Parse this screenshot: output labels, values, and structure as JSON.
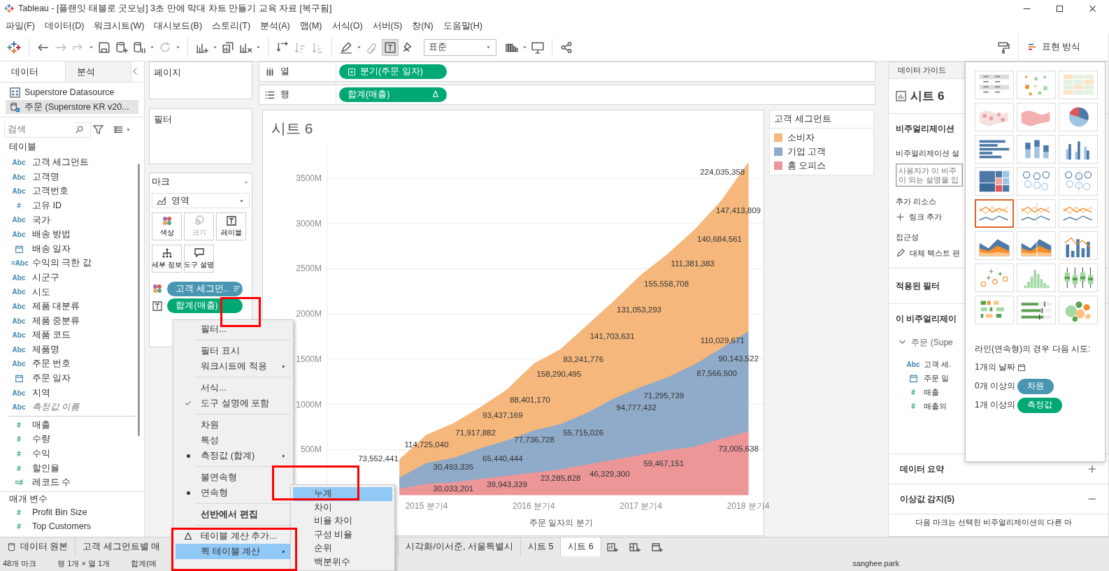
{
  "window": {
    "title": "Tableau - [플랜잇 태블로 굿모닝] 3초 만에 막대 차트 만들기 교육 자료 [복구됨]"
  },
  "menu": [
    "파일(F)",
    "데이터(D)",
    "워크시트(W)",
    "대시보드(B)",
    "스토리(T)",
    "분석(A)",
    "맵(M)",
    "서식(O)",
    "서버(S)",
    "창(N)",
    "도움말(H)"
  ],
  "toolbar": [
    {
      "kind": "logo"
    },
    {
      "kind": "sep"
    },
    {
      "kind": "undo",
      "disabled": false
    },
    {
      "kind": "redo",
      "disabled": true
    },
    {
      "kind": "replay",
      "disabled": true,
      "dropdown": true
    },
    {
      "kind": "save",
      "disabled": false
    },
    {
      "kind": "newds",
      "disabled": false
    },
    {
      "kind": "pause",
      "disabled": false,
      "dropdown": true
    },
    {
      "kind": "refresh",
      "disabled": true,
      "dropdown": true
    },
    {
      "kind": "sep"
    },
    {
      "kind": "newsheet",
      "disabled": false,
      "dropdown": true
    },
    {
      "kind": "duplicate",
      "disabled": false
    },
    {
      "kind": "clear",
      "disabled": false,
      "dropdown": true
    },
    {
      "kind": "sep"
    },
    {
      "kind": "swap",
      "disabled": false
    },
    {
      "kind": "sortasc",
      "disabled": true
    },
    {
      "kind": "sortdesc",
      "disabled": true
    },
    {
      "kind": "sep"
    },
    {
      "kind": "highlight",
      "disabled": false,
      "dropdown": true
    },
    {
      "kind": "group",
      "disabled": true
    },
    {
      "kind": "labels",
      "disabled": false,
      "on": true
    },
    {
      "kind": "fixaxes",
      "disabled": false
    },
    {
      "kind": "fit",
      "value": "표준"
    },
    {
      "kind": "cards",
      "disabled": false,
      "dropdown": true
    },
    {
      "kind": "present",
      "disabled": false
    },
    {
      "kind": "sep"
    },
    {
      "kind": "share",
      "disabled": false
    }
  ],
  "show_me_button": {
    "label": "표현 방식",
    "selected": true
  },
  "data_pane": {
    "tabs": [
      {
        "label": "데이터",
        "selected": true
      },
      {
        "label": "분석",
        "selected": false
      }
    ],
    "sources": [
      {
        "name": "Superstore Datasource",
        "selected": false
      },
      {
        "name": "주문 (Superstore KR v20...",
        "selected": true
      }
    ],
    "search": {
      "placeholder": "검색"
    },
    "tables_header": "테이블",
    "fields": [
      {
        "name": "고객 세그먼트",
        "kind": "typed",
        "type_label": "Abc",
        "measure": false
      },
      {
        "name": "고객명",
        "kind": "typed",
        "type_label": "Abc",
        "measure": false
      },
      {
        "name": "고객번호",
        "kind": "typed",
        "type_label": "Abc",
        "measure": false
      },
      {
        "name": "고유 ID",
        "kind": "typed",
        "type_label": "#",
        "measure": false
      },
      {
        "name": "국가",
        "kind": "typed",
        "type_label": "Abc",
        "measure": false
      },
      {
        "name": "배송 방법",
        "kind": "typed",
        "type_label": "Abc",
        "measure": false
      },
      {
        "name": "배송 일자",
        "kind": "date",
        "measure": false
      },
      {
        "name": "수익의 극한 값",
        "kind": "typed",
        "type_label": "=Abc",
        "measure": false
      },
      {
        "name": "시군구",
        "kind": "typed",
        "type_label": "Abc",
        "measure": false
      },
      {
        "name": "시도",
        "kind": "typed",
        "type_label": "Abc",
        "measure": false
      },
      {
        "name": "제품 대분류",
        "kind": "typed",
        "type_label": "Abc",
        "measure": false
      },
      {
        "name": "제품 중분류",
        "kind": "typed",
        "type_label": "Abc",
        "measure": false
      },
      {
        "name": "제품 코드",
        "kind": "typed",
        "type_label": "Abc",
        "measure": false
      },
      {
        "name": "제품명",
        "kind": "typed",
        "type_label": "Abc",
        "measure": false
      },
      {
        "name": "주문 번호",
        "kind": "typed",
        "type_label": "Abc",
        "measure": false
      },
      {
        "name": "주문 일자",
        "kind": "date",
        "measure": false
      },
      {
        "name": "지역",
        "kind": "typed",
        "type_label": "Abc",
        "measure": false
      },
      {
        "name": "측정값 이름",
        "kind": "typed",
        "type_label": "Abc",
        "measure": false,
        "italic": true
      },
      {
        "name": "매출",
        "kind": "typed",
        "type_label": "#",
        "measure": true
      },
      {
        "name": "수량",
        "kind": "typed",
        "type_label": "#",
        "measure": true
      },
      {
        "name": "수익",
        "kind": "typed",
        "type_label": "#",
        "measure": true
      },
      {
        "name": "할인율",
        "kind": "typed",
        "type_label": "#",
        "measure": true
      },
      {
        "name": "레코드 수",
        "kind": "typed",
        "type_label": "=#",
        "measure": true
      }
    ],
    "params_header": "매개 변수",
    "parameters": [
      {
        "name": "Profit Bin Size",
        "type_label": "#"
      },
      {
        "name": "Top Customers",
        "type_label": "#"
      }
    ]
  },
  "pages": {
    "title": "페이지"
  },
  "filters": {
    "title": "필터"
  },
  "marks": {
    "title": "마크",
    "mark_type": "영역",
    "buttons": [
      {
        "kind": "color",
        "label": "색상",
        "disabled": false
      },
      {
        "kind": "size",
        "label": "크기",
        "disabled": true
      },
      {
        "kind": "label",
        "label": "레이블",
        "disabled": false
      },
      {
        "kind": "detail",
        "label": "세부 정보",
        "disabled": false
      },
      {
        "kind": "tooltip",
        "label": "도구 설명",
        "disabled": false
      }
    ],
    "pills": [
      {
        "kind": "color",
        "label": "고객 세그먼..",
        "measure": false,
        "sorted": true
      },
      {
        "kind": "label",
        "label": "합계(매출)",
        "measure": true
      }
    ]
  },
  "columns_shelf": {
    "label": "열",
    "pill": {
      "label": "분기(주문 일자)",
      "measure": true,
      "expand": true
    }
  },
  "rows_shelf": {
    "label": "행",
    "pill": {
      "label": "합계(매출)",
      "measure": true,
      "table_calc_mark": "Δ"
    }
  },
  "view": {
    "title": "시트 6",
    "chart_data": {
      "type": "area",
      "xlabel": "주문 일자의 분기",
      "stacked": true,
      "grid": true,
      "categories": [
        null,
        null,
        null,
        "2015 분기4",
        null,
        null,
        null,
        "2016 분기4",
        null,
        null,
        null,
        "2017 분기4",
        null,
        null,
        null,
        "2018 분기4"
      ],
      "ylim": [
        0,
        3840
      ],
      "yticks": [
        {
          "value": 500,
          "label": "500M"
        },
        {
          "value": 1000,
          "label": "1000M"
        },
        {
          "value": 1500,
          "label": "1500M"
        },
        {
          "value": 2000,
          "label": "2000M"
        },
        {
          "value": 2500,
          "label": "2500M"
        },
        {
          "value": 3000,
          "label": "3000M"
        },
        {
          "value": 3500,
          "label": "3500M"
        }
      ],
      "series": [
        {
          "name": "홈 오피스",
          "color": "#ec9698",
          "values": [
            null,
            null,
            71,
            125,
            143,
            179,
            214,
            250,
            286,
            339,
            393,
            446,
            500,
            536,
            625,
            704
          ]
        },
        {
          "name": "기업 고객",
          "color": "#8fabc9",
          "values": [
            null,
            null,
            125,
            232,
            268,
            339,
            393,
            464,
            500,
            572,
            678,
            750,
            804,
            910,
            1000,
            1107
          ]
        },
        {
          "name": "소비자",
          "color": "#f5b77b",
          "values": [
            null,
            null,
            197,
            304,
            375,
            446,
            554,
            732,
            821,
            964,
            1072,
            1233,
            1357,
            1483,
            1625,
            1857
          ]
        }
      ],
      "annotations": [
        "73,552,441",
        "114,725,040",
        "71,917,882",
        "93,437,169",
        "88,401,170",
        "158,290,495",
        "83,241,776",
        "141,703,631",
        "131,053,293",
        "155,558,708",
        "111,381,383",
        "140,684,561",
        "147,413,809",
        "224,035,358",
        "30,493,335",
        "65,440,444",
        "77,736,728",
        "55,715,026",
        "94,777,432",
        "71,295,739",
        "87,566,500",
        "90,143,522",
        "110,029,671",
        "30,033,201",
        "39,943,339",
        "23,285,828",
        "46,329,300",
        "59,467,151",
        "73,005,638"
      ]
    }
  },
  "legend": {
    "title": "고객 세그먼트"
  },
  "data_guide": {
    "tab": "데이터 가이드",
    "sheet_title": "시트 6",
    "viz_heading": "비주얼리제이션",
    "desc_label": "비주얼리제이션 설",
    "desc_lines": [
      "사용자가 이 비주",
      "이 되는 설명을 입"
    ],
    "resources_label": "추가 리소스",
    "add_link": "링크 추가",
    "accessibility_label": "접근성",
    "alt_text": "대체 텍스트 편",
    "filters_heading": "적용된 필터",
    "fields_heading": "이 비주얼리제이",
    "source": {
      "name": "주문 (Supe",
      "expanded": true
    },
    "fields": [
      {
        "kind": "typed",
        "type_label": "Abc",
        "name": "고객 세.",
        "measure": false
      },
      {
        "kind": "date",
        "name": "주문 일",
        "measure": false
      },
      {
        "kind": "typed",
        "type_label": "#",
        "name": "매출",
        "measure": true
      },
      {
        "kind": "typed",
        "type_label": "#",
        "name": "매출의",
        "measure": true
      }
    ],
    "sections": [
      {
        "title": "데이터 요약",
        "expanded": false
      },
      {
        "title": "이상값 감지(5)",
        "expanded": true
      }
    ],
    "outlier_text": "다음 마크는 선택한 비주얼리제이션의 다른 마"
  },
  "show_me": {
    "charts": [
      {
        "kind": "text-table",
        "selected": false
      },
      {
        "kind": "heat-map",
        "selected": false
      },
      {
        "kind": "highlight-table",
        "selected": false
      },
      {
        "kind": "symbol-map",
        "selected": false
      },
      {
        "kind": "filled-map",
        "selected": false
      },
      {
        "kind": "pie-chart",
        "selected": false
      },
      {
        "kind": "horizontal-bars",
        "selected": false
      },
      {
        "kind": "stacked-bars",
        "selected": false
      },
      {
        "kind": "side-by-side-bars",
        "selected": false
      },
      {
        "kind": "treemap",
        "selected": false
      },
      {
        "kind": "circle-view",
        "selected": false
      },
      {
        "kind": "side-by-side-circles",
        "selected": false
      },
      {
        "kind": "line-chart",
        "selected": true
      },
      {
        "kind": "discrete-line-chart",
        "selected": false
      },
      {
        "kind": "dual-line-chart",
        "selected": false
      },
      {
        "kind": "area-chart",
        "selected": false
      },
      {
        "kind": "discrete-area-chart",
        "selected": false
      },
      {
        "kind": "dual-combination-chart",
        "selected": false
      },
      {
        "kind": "scatter-plot",
        "selected": false
      },
      {
        "kind": "histogram",
        "selected": false
      },
      {
        "kind": "box-plot",
        "selected": false
      },
      {
        "kind": "gantt-chart",
        "selected": false
      },
      {
        "kind": "bullet-graph",
        "selected": false
      },
      {
        "kind": "packed-bubbles",
        "selected": false
      }
    ],
    "hint_title": "라인(연속형)의 경우 다음 시도:",
    "hints": [
      {
        "kind": "date",
        "text": "1개의 날짜"
      },
      {
        "kind": "pill",
        "text": "0개 이상의",
        "pill": "차원",
        "measure": false
      },
      {
        "kind": "pill",
        "text": "1개 이상의",
        "pill": "측정값",
        "measure": true
      }
    ]
  },
  "context_menu": {
    "items": [
      {
        "kind": "item",
        "label": "필터...",
        "selected": false
      },
      {
        "kind": "separator"
      },
      {
        "kind": "item",
        "label": "필터 표시",
        "selected": false
      },
      {
        "kind": "item",
        "label": "워크시트에 적용",
        "submenu": true,
        "selected": false
      },
      {
        "kind": "separator"
      },
      {
        "kind": "item",
        "label": "서식...",
        "selected": false
      },
      {
        "kind": "item",
        "label": "도구 설명에 포함",
        "checked": true,
        "selected": false
      },
      {
        "kind": "separator"
      },
      {
        "kind": "item",
        "label": "차원",
        "selected": false
      },
      {
        "kind": "item",
        "label": "특성",
        "selected": false
      },
      {
        "kind": "item",
        "label": "측정값 (합계)",
        "radio": true,
        "submenu": true,
        "selected": false
      },
      {
        "kind": "separator"
      },
      {
        "kind": "item",
        "label": "불연속형",
        "selected": false
      },
      {
        "kind": "item",
        "label": "연속형",
        "radio": true,
        "selected": false
      },
      {
        "kind": "separator"
      },
      {
        "kind": "item",
        "label": "선반에서 편집",
        "bold": true,
        "selected": false
      },
      {
        "kind": "separator"
      },
      {
        "kind": "item",
        "label": "테이블 계산 추가...",
        "calc_icon": true,
        "selected": false
      },
      {
        "kind": "item",
        "label": "퀵 테이블 계산",
        "submenu": true,
        "selected": true
      }
    ],
    "submenu": [
      {
        "label": "누계",
        "selected": true
      },
      {
        "label": "차이",
        "selected": false
      },
      {
        "label": "비율 차이",
        "selected": false
      },
      {
        "label": "구성 비율",
        "selected": false
      },
      {
        "label": "순위",
        "selected": false
      },
      {
        "label": "백분위수",
        "selected": false
      }
    ]
  },
  "sheet_tabs": [
    {
      "kind": "datasource",
      "label": "데이터 원본",
      "selected": false
    },
    {
      "kind": "sheet",
      "label": "고객 세그먼트별 매",
      "selected": false
    },
    {
      "kind": "sheet",
      "label": "시각화/이서준, 서울특별시",
      "selected": false
    },
    {
      "kind": "sheet",
      "label": "시트 5",
      "selected": false
    },
    {
      "kind": "sheet",
      "label": "시트 6",
      "selected": true
    }
  ],
  "status_bar": {
    "marks": "48개 마크",
    "shape": "행 1개 × 열 1개",
    "measure": "합계(매",
    "user": "sanghee.park"
  }
}
